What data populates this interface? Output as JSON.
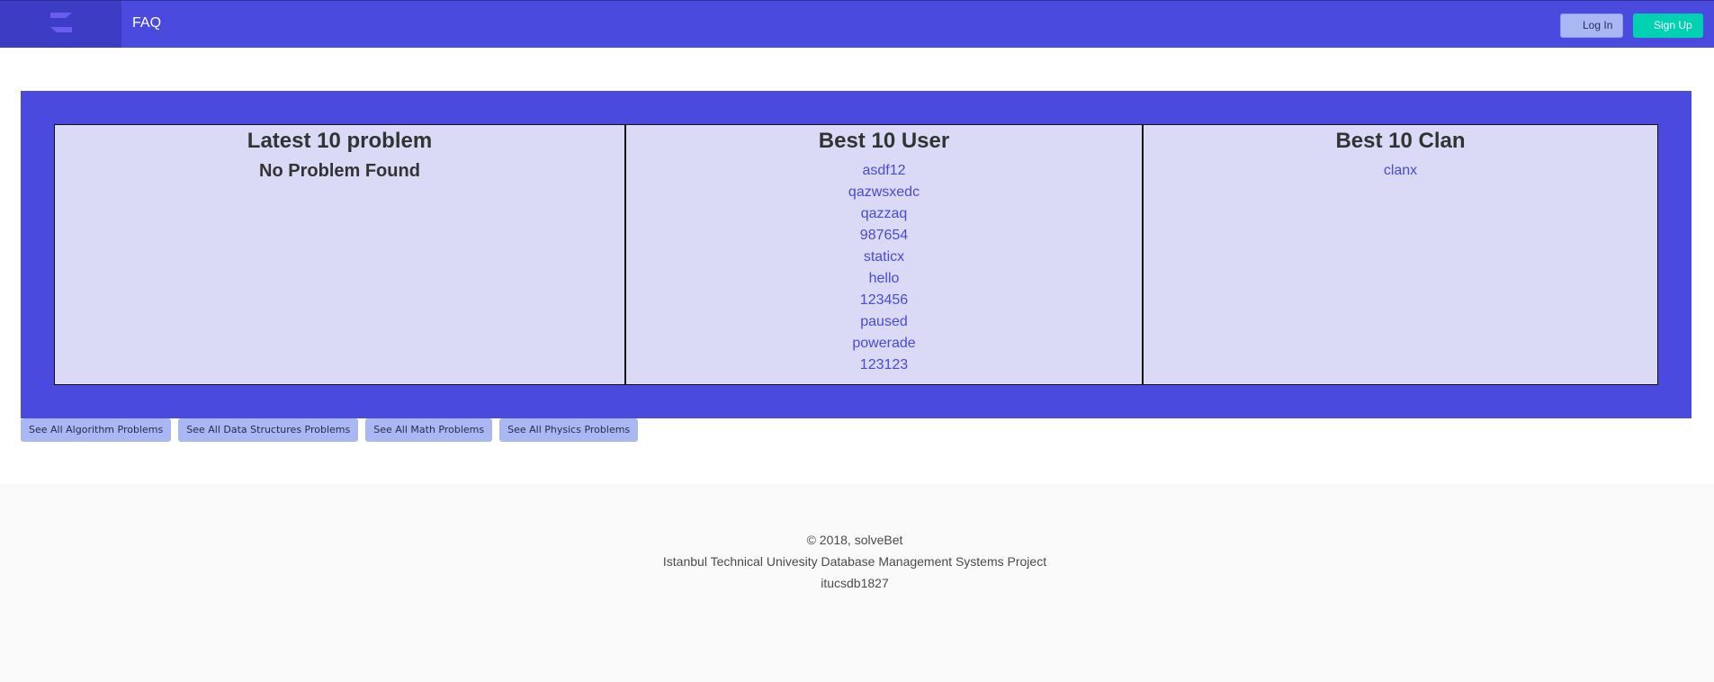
{
  "nav": {
    "faq_label": "FAQ",
    "login_label": "Log In",
    "signup_label": "Sign Up",
    "logo_icon": "brand-logo-icon"
  },
  "columns": [
    {
      "title": "Latest 10 problem",
      "empty_message": "No Problem Found"
    },
    {
      "title": "Best 10 User",
      "items": [
        "asdf12",
        "qazwsxedc",
        "qazzaq",
        "987654",
        "staticx",
        "hello",
        "123456",
        "paused",
        "powerade",
        "123123"
      ]
    },
    {
      "title": "Best 10 Clan",
      "items": [
        "clanx"
      ]
    }
  ],
  "categories": [
    "See All Algorithm Problems",
    "See All Data Structures Problems",
    "See All Math Problems",
    "See All Physics Problems"
  ],
  "footer": {
    "copyright": "© 2018, solveBet",
    "project": "Istanbul Technical Univesity Database Management Systems Project",
    "code": "itucsdb1827"
  },
  "colors": {
    "primary": "#4a4adf",
    "brand_bg": "#3c3cc4",
    "card_bg": "#dadaf6",
    "link": "#4a4ad2",
    "signup": "#00d1b2",
    "light_button": "#a9b8f3"
  }
}
